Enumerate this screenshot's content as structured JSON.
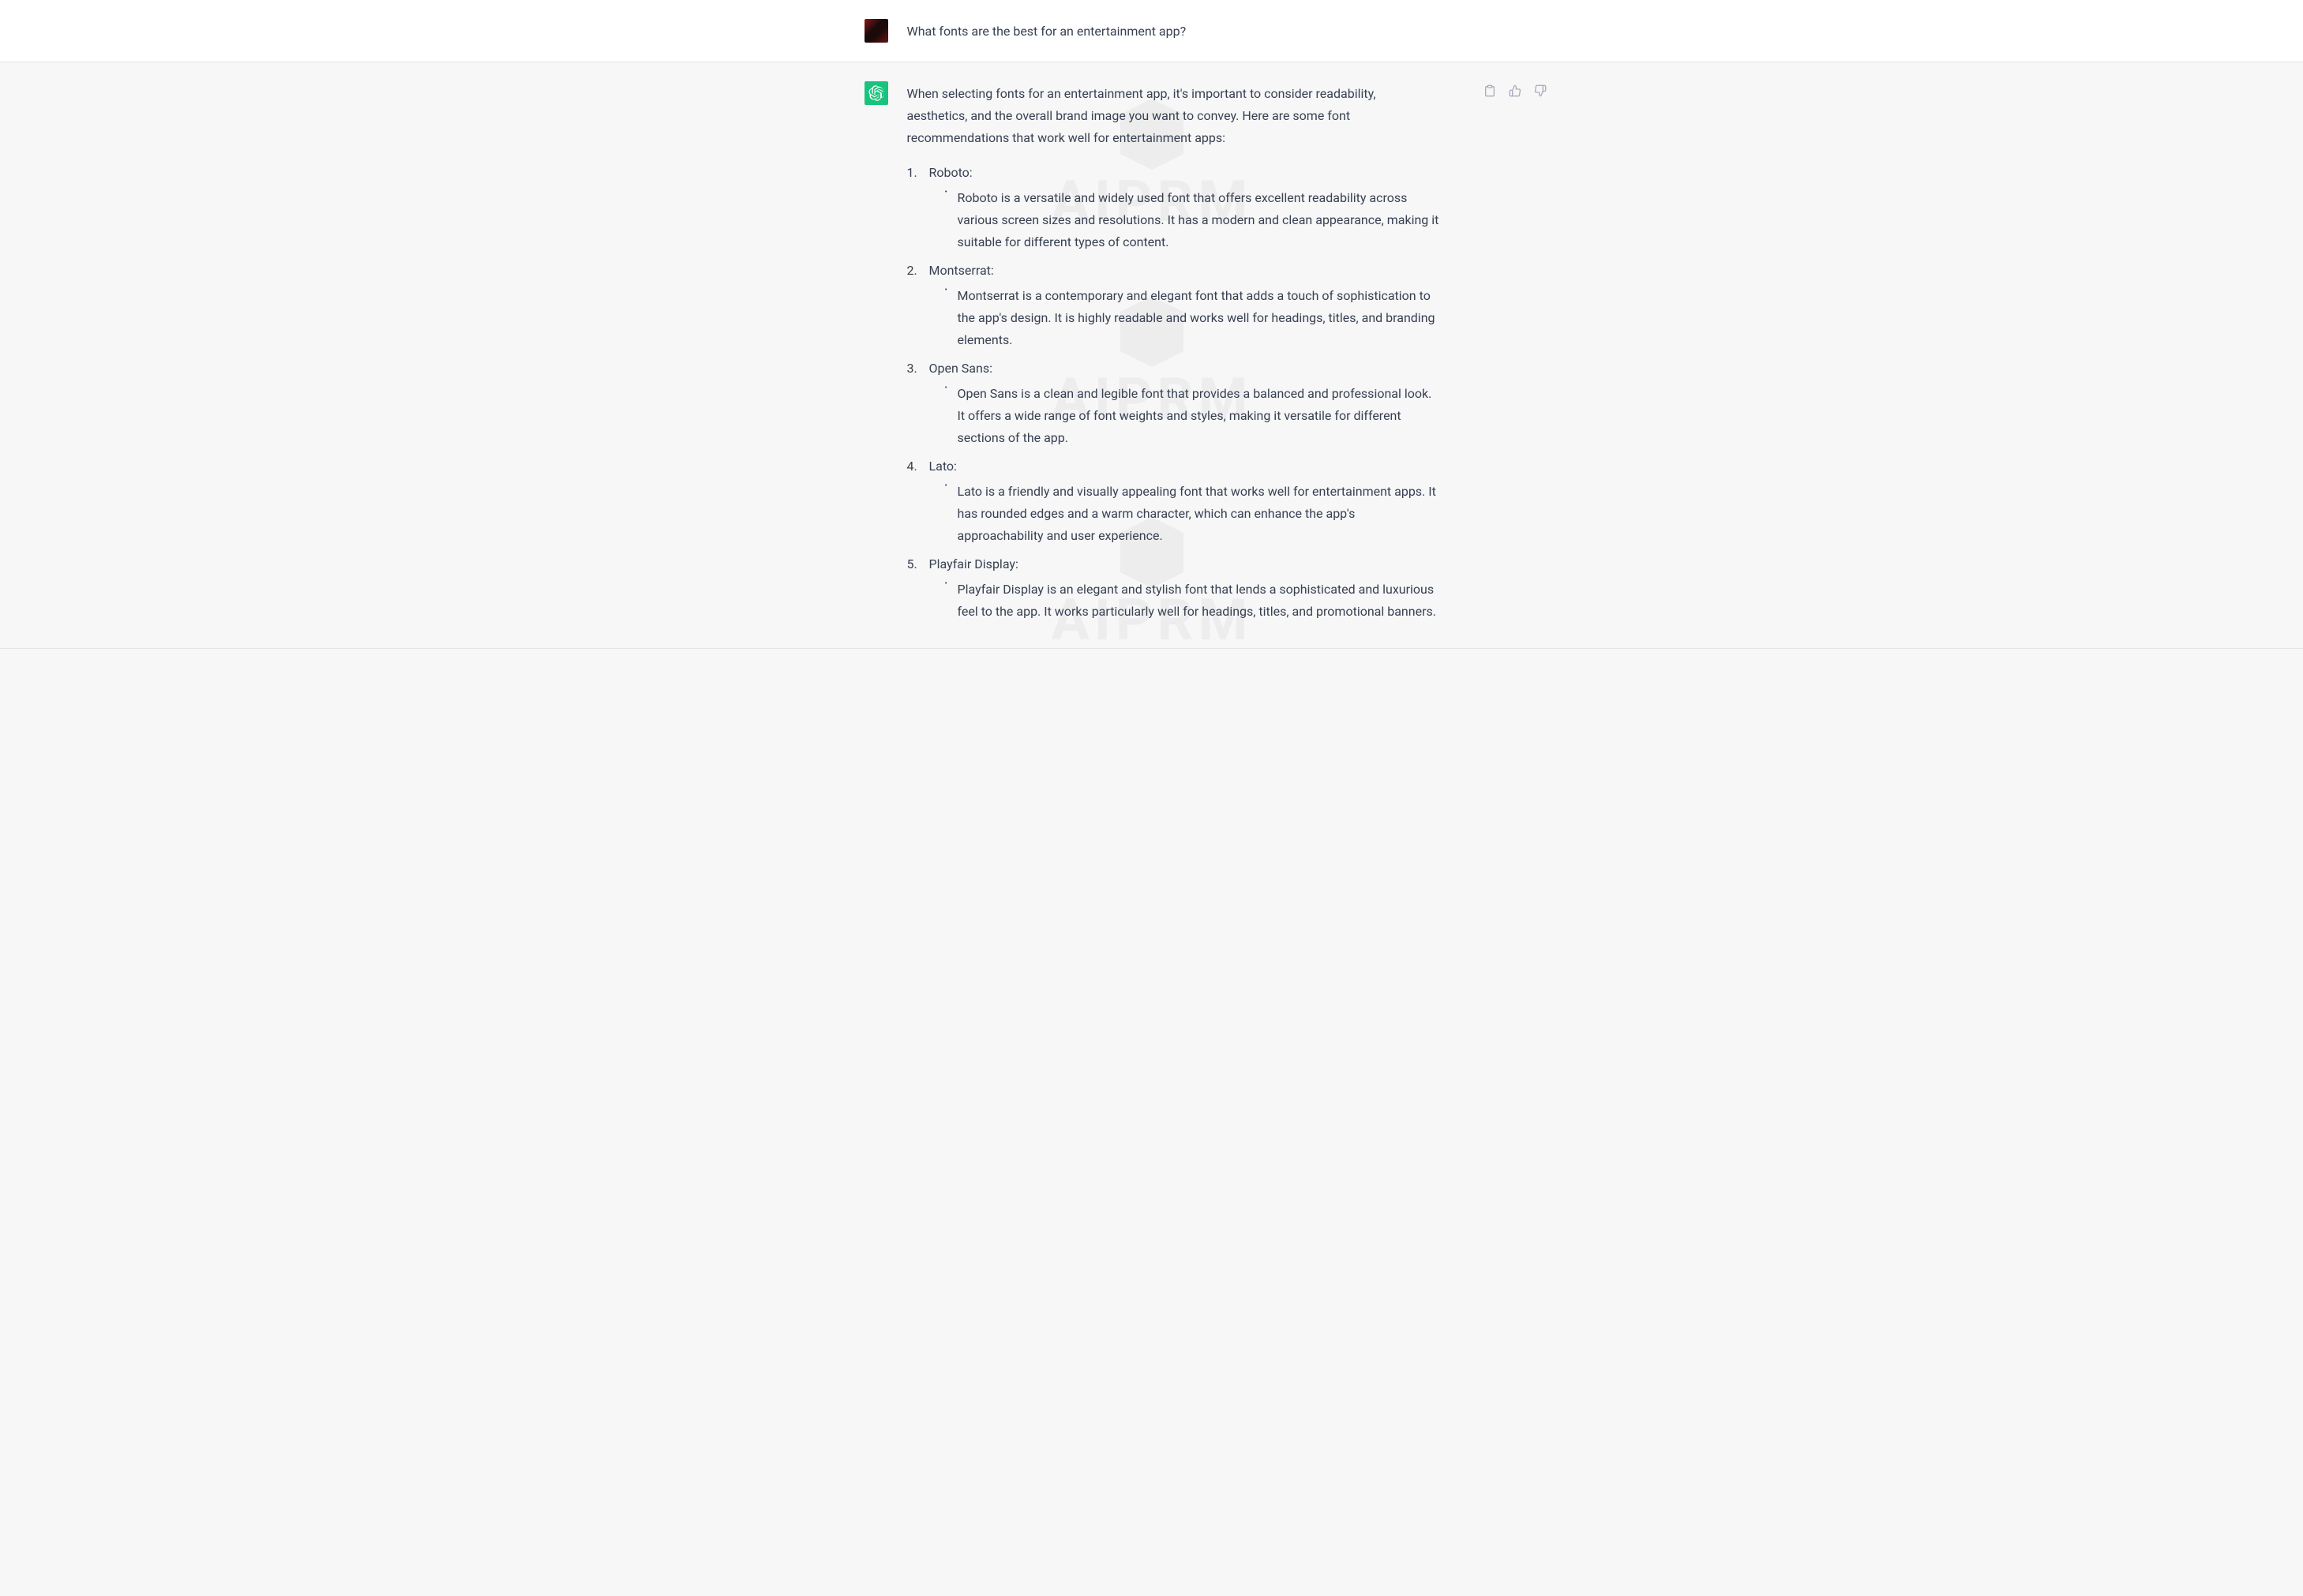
{
  "user_message": {
    "text": "What fonts are the best for an entertainment app?"
  },
  "assistant_message": {
    "intro": "When selecting fonts for an entertainment app, it's important to consider readability, aesthetics, and the overall brand image you want to convey. Here are some font recommendations that work well for entertainment apps:",
    "fonts": [
      {
        "name": "Roboto:",
        "description": "Roboto is a versatile and widely used font that offers excellent readability across various screen sizes and resolutions. It has a modern and clean appearance, making it suitable for different types of content."
      },
      {
        "name": "Montserrat:",
        "description": "Montserrat is a contemporary and elegant font that adds a touch of sophistication to the app's design. It is highly readable and works well for headings, titles, and branding elements."
      },
      {
        "name": "Open Sans:",
        "description": "Open Sans is a clean and legible font that provides a balanced and professional look. It offers a wide range of font weights and styles, making it versatile for different sections of the app."
      },
      {
        "name": "Lato:",
        "description": "Lato is a friendly and visually appealing font that works well for entertainment apps. It has rounded edges and a warm character, which can enhance the app's approachability and user experience."
      },
      {
        "name": "Playfair Display:",
        "description": "Playfair Display is an elegant and stylish font that lends a sophisticated and luxurious feel to the app. It works particularly well for headings, titles, and promotional banners."
      }
    ]
  },
  "actions": {
    "copy": "Copy",
    "thumbs_up": "Like",
    "thumbs_down": "Dislike"
  },
  "watermark": "AIPRM"
}
